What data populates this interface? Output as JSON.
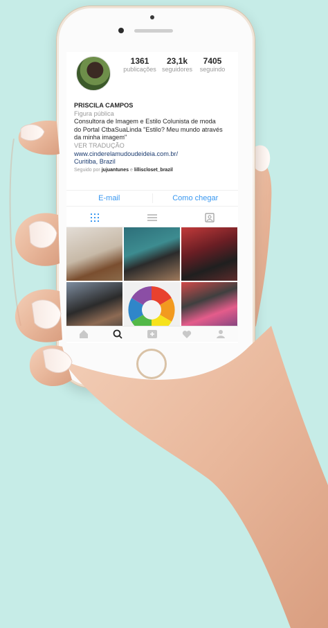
{
  "profile": {
    "stats": [
      {
        "value": "1361",
        "label": "publicações"
      },
      {
        "value": "23,1k",
        "label": "seguidores"
      },
      {
        "value": "7405",
        "label": "seguindo"
      }
    ],
    "name": "PRISCILA CAMPOS",
    "category": "Figura pública",
    "bio_line1": "Consultora de Imagem e Estilo Colunista de moda",
    "bio_line2": "do Portal CtbaSuaLinda \"Estilo? Meu mundo através",
    "bio_line3": "da minha imagem\"",
    "translate": "VER TRADUÇÃO",
    "website": "www.cinderelamudoudeideia.com.br/",
    "location": "Curitiba, Brazil",
    "followed_by_prefix": "Seguido por",
    "followed_by_1": "jujuantunes",
    "followed_by_and": "e",
    "followed_by_2": "lilliscloset_brazil"
  },
  "actions": {
    "email": "E-mail",
    "directions": "Como chegar"
  },
  "icons": {
    "grid_tab": "grid-icon",
    "list_tab": "list-icon",
    "tagged_tab": "tagged-icon",
    "home": "home-icon",
    "search": "search-icon",
    "add": "add-icon",
    "activity": "heart-icon",
    "profile": "profile-icon"
  },
  "colors": {
    "background": "#c6ece7",
    "link_blue": "#3897f0",
    "phone_gold": "#eddcc9"
  }
}
